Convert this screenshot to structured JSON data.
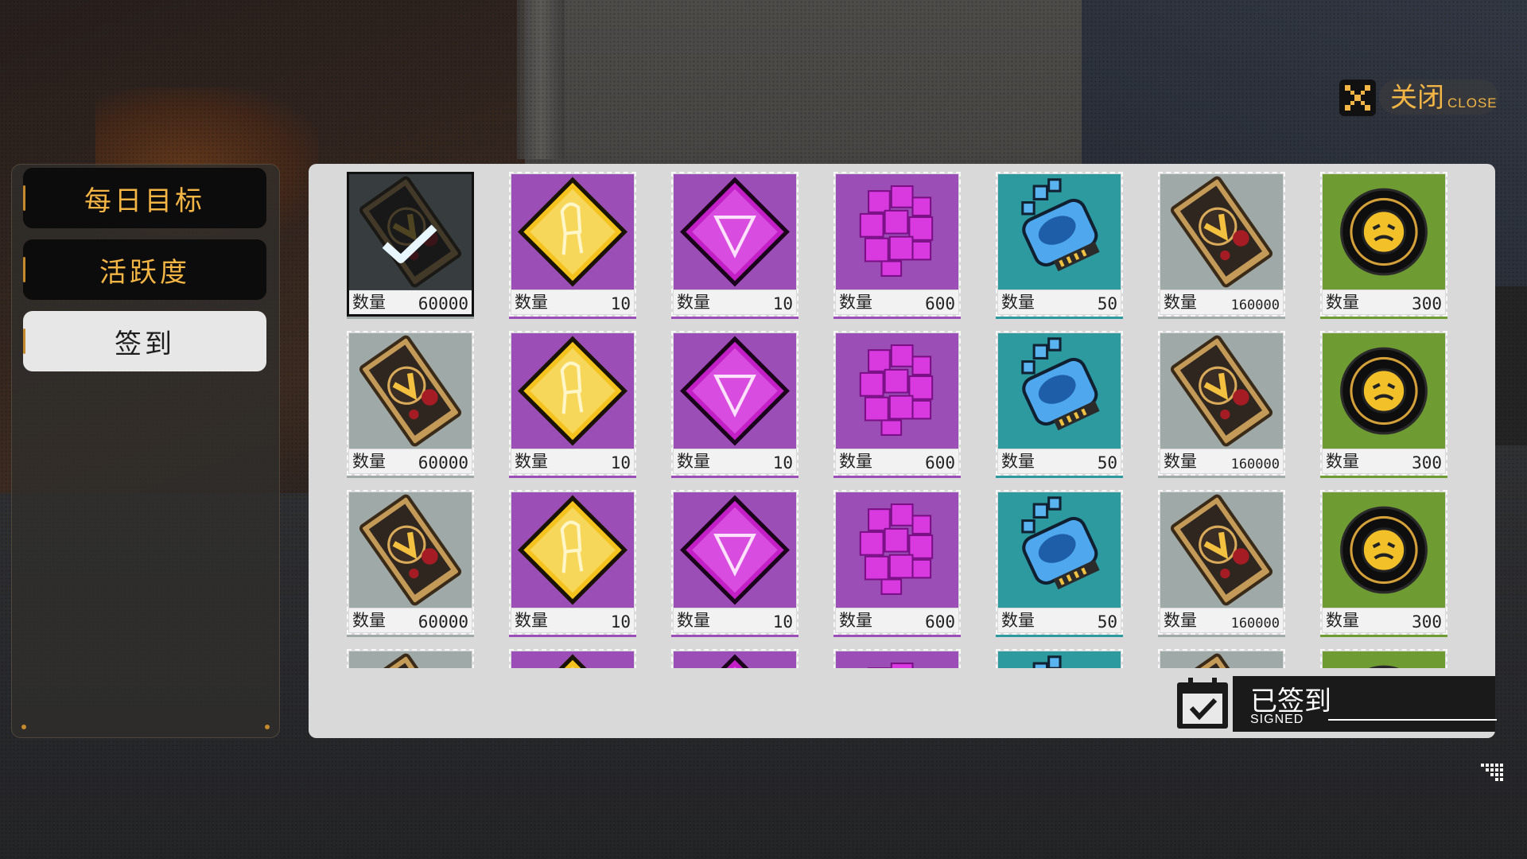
{
  "close_button": {
    "label": "关闭",
    "sublabel": "CLOSE"
  },
  "sidebar": {
    "items": [
      {
        "label": "每日目标",
        "active": false
      },
      {
        "label": "活跃度",
        "active": false
      },
      {
        "label": "签到",
        "active": true
      }
    ]
  },
  "rewards": {
    "quantity_label": "数量",
    "columns": [
      {
        "item": "coin-card",
        "quantity": "60000",
        "bg": "#9fa9a8"
      },
      {
        "item": "gold-chair-card",
        "quantity": "10",
        "bg": "#9b4fb6"
      },
      {
        "item": "purple-diamond-card",
        "quantity": "10",
        "bg": "#9b4fb6"
      },
      {
        "item": "purple-cube",
        "quantity": "600",
        "bg": "#9b4fb6"
      },
      {
        "item": "blue-chip",
        "quantity": "50",
        "bg": "#2d9aa0"
      },
      {
        "item": "coin-card",
        "quantity": "160000",
        "bg": "#9fa9a8"
      },
      {
        "item": "black-disc-coin",
        "quantity": "300",
        "bg": "#6f9c32"
      }
    ],
    "rows": [
      {
        "claimed": [
          true,
          false,
          false,
          false,
          false,
          false,
          false
        ]
      },
      {
        "claimed": [
          false,
          false,
          false,
          false,
          false,
          false,
          false
        ]
      },
      {
        "claimed": [
          false,
          false,
          false,
          false,
          false,
          false,
          false
        ]
      },
      {
        "claimed": [
          false,
          false,
          false,
          false,
          false,
          false,
          false
        ]
      }
    ]
  },
  "signed_badge": {
    "label": "已签到",
    "sublabel": "SIGNED"
  },
  "colors": {
    "accent": "#f3b544",
    "panel": "#d9d9d9",
    "sidebar_dark": "#0c0c0c"
  }
}
